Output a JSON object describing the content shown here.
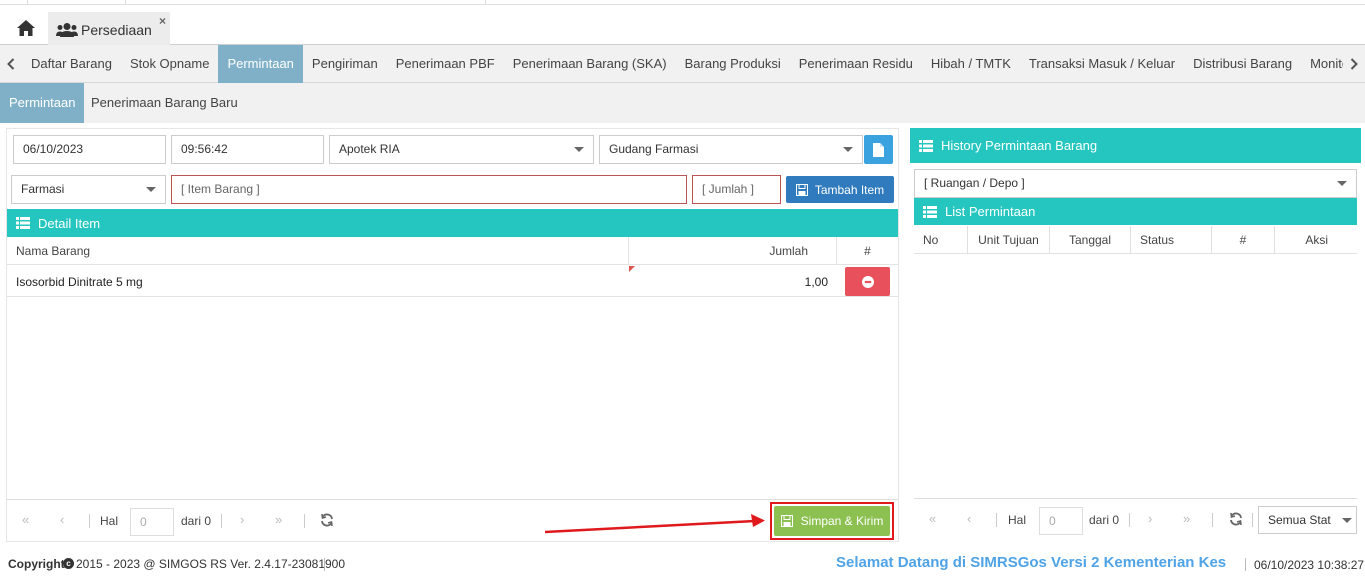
{
  "tab": {
    "title": "Persediaan",
    "close": "×"
  },
  "menu": {
    "items": [
      "Daftar Barang",
      "Stok Opname",
      "Permintaan",
      "Pengiriman",
      "Penerimaan PBF",
      "Penerimaan Barang (SKA)",
      "Barang Produksi",
      "Penerimaan Residu",
      "Hibah / TMTK",
      "Transaksi Masuk / Keluar",
      "Distribusi Barang",
      "Monitoring",
      "Moni"
    ],
    "active_index": 2
  },
  "submenu": {
    "items": [
      "Permintaan",
      "Penerimaan Barang Baru"
    ]
  },
  "form": {
    "date": "06/10/2023",
    "time": "09:56:42",
    "unit": "Apotek RIA",
    "gudang": "Gudang Farmasi",
    "kategori": "Farmasi",
    "item_placeholder": "[ Item Barang ]",
    "jumlah_placeholder": "[ Jumlah ]",
    "tambah_label": "Tambah Item"
  },
  "detail": {
    "title": "Detail Item",
    "columns": {
      "nama": "Nama Barang",
      "jumlah": "Jumlah",
      "hash": "#"
    },
    "rows": [
      {
        "nama": "Isosorbid Dinitrate 5 mg",
        "jumlah": "1,00"
      }
    ]
  },
  "left_pager": {
    "hal": "Hal",
    "page": "0",
    "dari": "dari 0"
  },
  "simpan_label": "Simpan & Kirim",
  "history": {
    "title": "History Permintaan Barang",
    "ruangan_placeholder": "[ Ruangan / Depo ]",
    "list_title": "List Permintaan",
    "columns": [
      "No",
      "Unit Tujuan",
      "Tanggal",
      "Status",
      "#",
      "Aksi"
    ]
  },
  "right_pager": {
    "hal": "Hal",
    "page": "0",
    "dari": "dari 0",
    "status": "Semua Stat"
  },
  "footer": {
    "copyright": "Copyright",
    "version": "2015 - 2023 @ SIMGOS RS Ver. 2.4.17-23081900",
    "welcome": "Selamat Datang di SIMRSGos Versi 2 Kementerian Kes",
    "datetime": "06/10/2023 10:38:27"
  },
  "colors": {
    "teal": "#25c6bf",
    "active_tab": "#7fb0c8",
    "button_blue": "#2f7bbd",
    "button_green": "#8cc152",
    "delete_red": "#e8505b",
    "annotation_red": "#e0191c"
  }
}
